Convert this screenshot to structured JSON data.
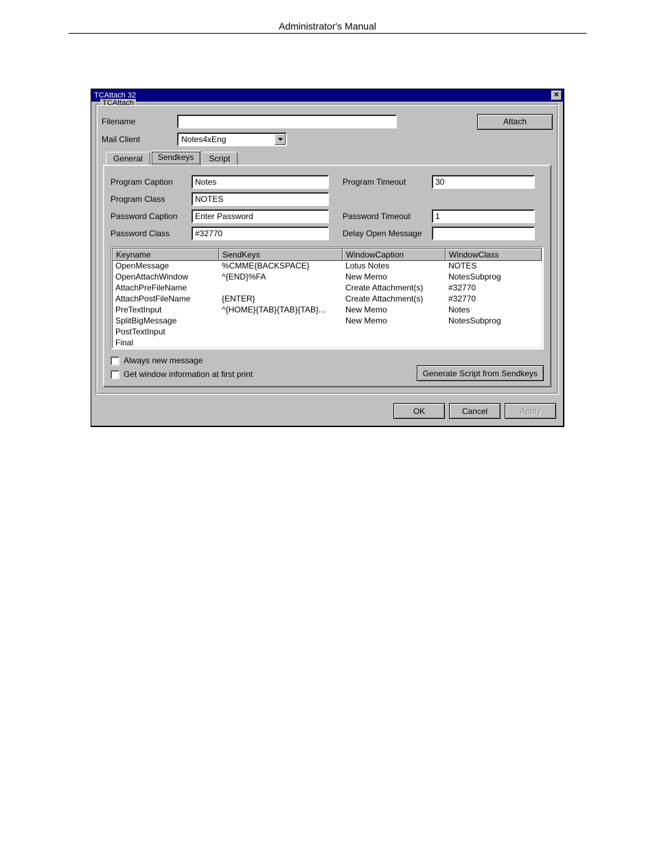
{
  "page_header": "Administrator's Manual",
  "dialog": {
    "title": "TCAttach 32",
    "groupbox_label": "TCAttach",
    "filename_label": "Filename",
    "filename_value": "",
    "attach_button": "Attach",
    "mailclient_label": "Mail Client",
    "mailclient_value": "Notes4xEng",
    "tabs": {
      "general": "General",
      "sendkeys": "Sendkeys",
      "script": "Script"
    },
    "fields": {
      "program_caption_label": "Program Caption",
      "program_caption_value": "Notes",
      "program_timeout_label": "Program Timeout",
      "program_timeout_value": "30",
      "program_class_label": "Program Class",
      "program_class_value": "NOTES",
      "password_caption_label": "Password Caption",
      "password_caption_value": "Enter Password",
      "password_timeout_label": "Password Timeout",
      "password_timeout_value": "1",
      "password_class_label": "Password Class",
      "password_class_value": "#32770",
      "delay_open_label": "Delay Open Message",
      "delay_open_value": ""
    },
    "table": {
      "headers": {
        "keyname": "Keyname",
        "sendkeys": "SendKeys",
        "windowcaption": "WindowCaption",
        "windowclass": "WindowClass"
      },
      "rows": [
        {
          "k": "OpenMessage",
          "s": "%CMME{BACKSPACE}",
          "wc": "Lotus Notes",
          "wcl": "NOTES"
        },
        {
          "k": "OpenAttachWindow",
          "s": "^{END}%FA",
          "wc": "New Memo",
          "wcl": "NotesSubprog"
        },
        {
          "k": "AttachPreFileName",
          "s": "",
          "wc": "Create Attachment(s)",
          "wcl": "#32770"
        },
        {
          "k": "AttachPostFileName",
          "s": "{ENTER}",
          "wc": "Create Attachment(s)",
          "wcl": "#32770"
        },
        {
          "k": "PreTextInput",
          "s": "^{HOME}{TAB}{TAB}{TAB}...",
          "wc": "New Memo",
          "wcl": "Notes"
        },
        {
          "k": "SplitBigMessage",
          "s": "",
          "wc": "New Memo",
          "wcl": "NotesSubprog"
        },
        {
          "k": "PostTextInput",
          "s": "",
          "wc": "",
          "wcl": ""
        },
        {
          "k": "Final",
          "s": "",
          "wc": "",
          "wcl": ""
        }
      ]
    },
    "chk_always_new": "Always new message",
    "chk_getwin": "Get window information at first print",
    "gen_script_btn": "Generate Script from Sendkeys",
    "ok": "OK",
    "cancel": "Cancel",
    "apply": "Apply"
  }
}
